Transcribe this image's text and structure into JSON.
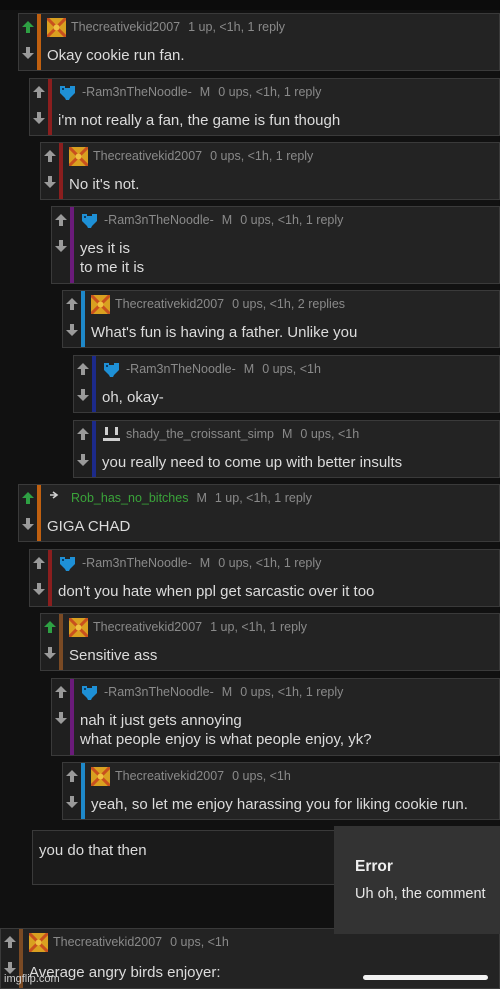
{
  "colors": {
    "bar_orange": "#c06010",
    "bar_red": "#8b1e1e",
    "bar_purple": "#6a1b7a",
    "bar_blue": "#1e88c9",
    "bar_navy": "#1c2a8a",
    "bar_brown": "#7a4a24",
    "upvote_active": "#2ea043"
  },
  "comments": [
    {
      "user": "Thecreativekid2007",
      "mod": "",
      "stats": "1 up, <1h, 1 reply",
      "lines": [
        "Okay cookie run fan."
      ],
      "avatar": "creative-avatar-icon"
    },
    {
      "user": "-Ram3nTheNoodle-",
      "mod": "M",
      "stats": "0 ups, <1h, 1 reply",
      "lines": [
        "i'm not really a fan, the game is fun though"
      ],
      "avatar": "heart-avatar-icon"
    },
    {
      "user": "Thecreativekid2007",
      "mod": "",
      "stats": "0 ups, <1h, 1 reply",
      "lines": [
        "No it's not."
      ],
      "avatar": "creative-avatar-icon"
    },
    {
      "user": "-Ram3nTheNoodle-",
      "mod": "M",
      "stats": "0 ups, <1h, 1 reply",
      "lines": [
        "yes it is",
        "to me it is"
      ],
      "avatar": "heart-avatar-icon"
    },
    {
      "user": "Thecreativekid2007",
      "mod": "",
      "stats": "0 ups, <1h, 2 replies",
      "lines": [
        "What's fun is having a father. Unlike you"
      ],
      "avatar": "creative-avatar-icon"
    },
    {
      "user": "-Ram3nTheNoodle-",
      "mod": "M",
      "stats": "0 ups, <1h",
      "lines": [
        "oh, okay-"
      ],
      "avatar": "heart-avatar-icon"
    },
    {
      "user": "shady_the_croissant_simp",
      "mod": "M",
      "stats": "0 ups, <1h",
      "lines": [
        "you really need to come up with better insults"
      ],
      "avatar": "face-avatar-icon"
    },
    {
      "user": "Rob_has_no_bitches",
      "mod": "M",
      "stats": "1 up, <1h, 1 reply",
      "lines": [
        "GIGA CHAD"
      ],
      "avatar": "rob-avatar-icon"
    },
    {
      "user": "-Ram3nTheNoodle-",
      "mod": "M",
      "stats": "0 ups, <1h, 1 reply",
      "lines": [
        "don't you hate when ppl get sarcastic over it too"
      ],
      "avatar": "heart-avatar-icon"
    },
    {
      "user": "Thecreativekid2007",
      "mod": "",
      "stats": "1 up, <1h, 1 reply",
      "lines": [
        "Sensitive ass"
      ],
      "avatar": "creative-avatar-icon"
    },
    {
      "user": "-Ram3nTheNoodle-",
      "mod": "M",
      "stats": "0 ups, <1h, 1 reply",
      "lines": [
        "nah it just gets annoying",
        "what people enjoy is what people enjoy, yk?"
      ],
      "avatar": "heart-avatar-icon"
    },
    {
      "user": "Thecreativekid2007",
      "mod": "",
      "stats": "0 ups, <1h",
      "lines": [
        "yeah, so let me enjoy harassing you for liking cookie run."
      ],
      "avatar": "creative-avatar-icon"
    },
    {
      "user": "Thecreativekid2007",
      "mod": "",
      "stats": "0 ups, <1h",
      "lines": [
        "Average angry birds enjoyer:"
      ],
      "avatar": "creative-avatar-icon"
    }
  ],
  "reply_box": {
    "value": "you do that then"
  },
  "error_toast": {
    "title": "Error",
    "message": "Uh oh, the comment"
  },
  "watermark": "imgflip.com"
}
